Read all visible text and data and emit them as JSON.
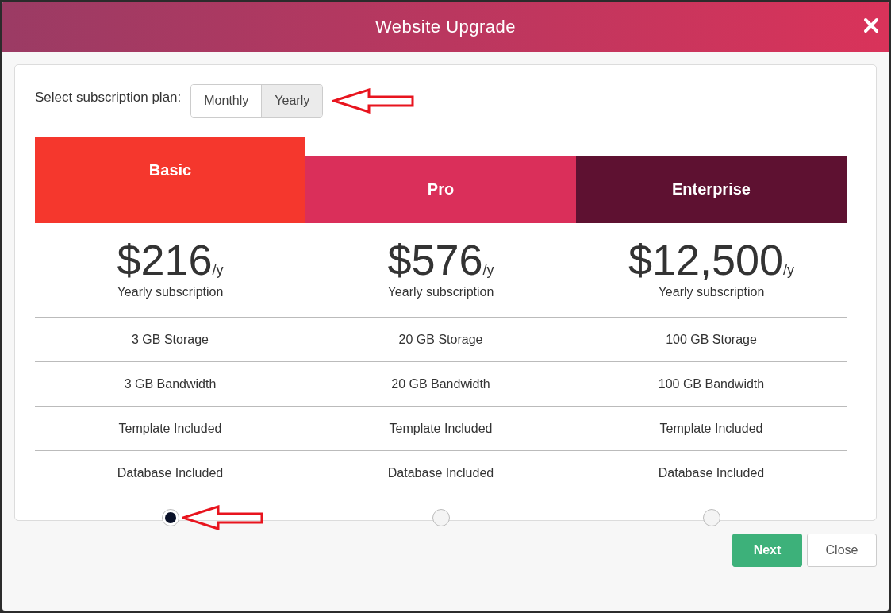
{
  "window": {
    "title": "Website Upgrade"
  },
  "plan_selector": {
    "label": "Select subscription plan:",
    "options": [
      {
        "label": "Monthly",
        "selected": false
      },
      {
        "label": "Yearly",
        "selected": true
      }
    ]
  },
  "plans": [
    {
      "name": "Basic",
      "color": "#f5372d",
      "price": "$216",
      "period": "/y",
      "note": "Yearly subscription",
      "features": [
        "3 GB Storage",
        "3 GB Bandwidth",
        "Template Included",
        "Database Included"
      ],
      "selected": true
    },
    {
      "name": "Pro",
      "color": "#da2f5a",
      "price": "$576",
      "period": "/y",
      "note": "Yearly subscription",
      "features": [
        "20 GB Storage",
        "20 GB Bandwidth",
        "Template Included",
        "Database Included"
      ],
      "selected": false
    },
    {
      "name": "Enterprise",
      "color": "#5e1131",
      "price": "$12,500",
      "period": "/y",
      "note": "Yearly subscription",
      "features": [
        "100 GB Storage",
        "100 GB Bandwidth",
        "Template Included",
        "Database Included"
      ],
      "selected": false
    }
  ],
  "buttons": [
    {
      "label": "Next",
      "kind": "primary"
    },
    {
      "label": "Close",
      "kind": "secondary"
    }
  ]
}
